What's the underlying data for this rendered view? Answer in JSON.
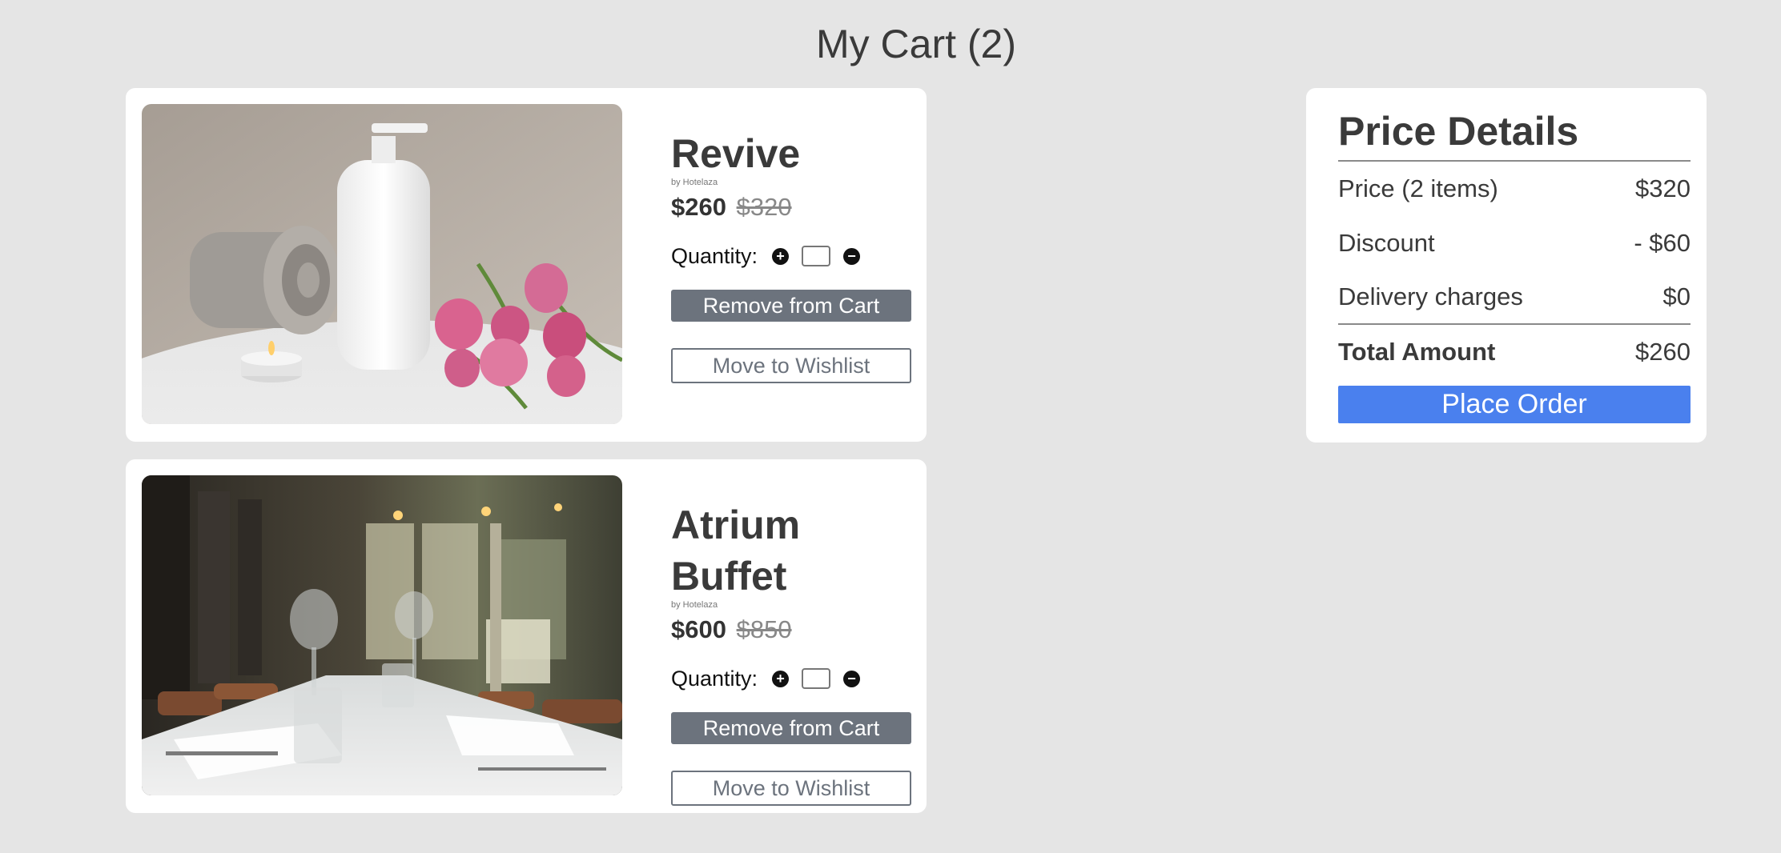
{
  "page": {
    "title": "My Cart (2)"
  },
  "cart": {
    "items": [
      {
        "name": "Revive",
        "brand": "by Hotelaza",
        "price": "$260",
        "original_price": "$320",
        "quantity_label": "Quantity:",
        "quantity_value": "",
        "remove_label": "Remove from Cart",
        "wishlist_label": "Move to Wishlist",
        "image": "spa-towel-bottle-tulips-photo"
      },
      {
        "name": "Atrium Buffet",
        "brand": "by Hotelaza",
        "price": "$600",
        "original_price": "$850",
        "quantity_label": "Quantity:",
        "quantity_value": "",
        "remove_label": "Remove from Cart",
        "wishlist_label": "Move to Wishlist",
        "image": "restaurant-dining-table-photo"
      }
    ]
  },
  "price_details": {
    "title": "Price Details",
    "rows": [
      {
        "label": "Price (2 items)",
        "value": "$320"
      },
      {
        "label": "Discount",
        "value": "- $60"
      },
      {
        "label": "Delivery charges",
        "value": "$0"
      }
    ],
    "total_label": "Total Amount",
    "total_value": "$260",
    "place_order_label": "Place Order"
  },
  "icons": {
    "plus": "plus-circle-icon",
    "minus": "minus-circle-icon"
  },
  "colors": {
    "background": "#e5e5e5",
    "primary": "#4a80ee",
    "secondary": "#6c737d"
  }
}
